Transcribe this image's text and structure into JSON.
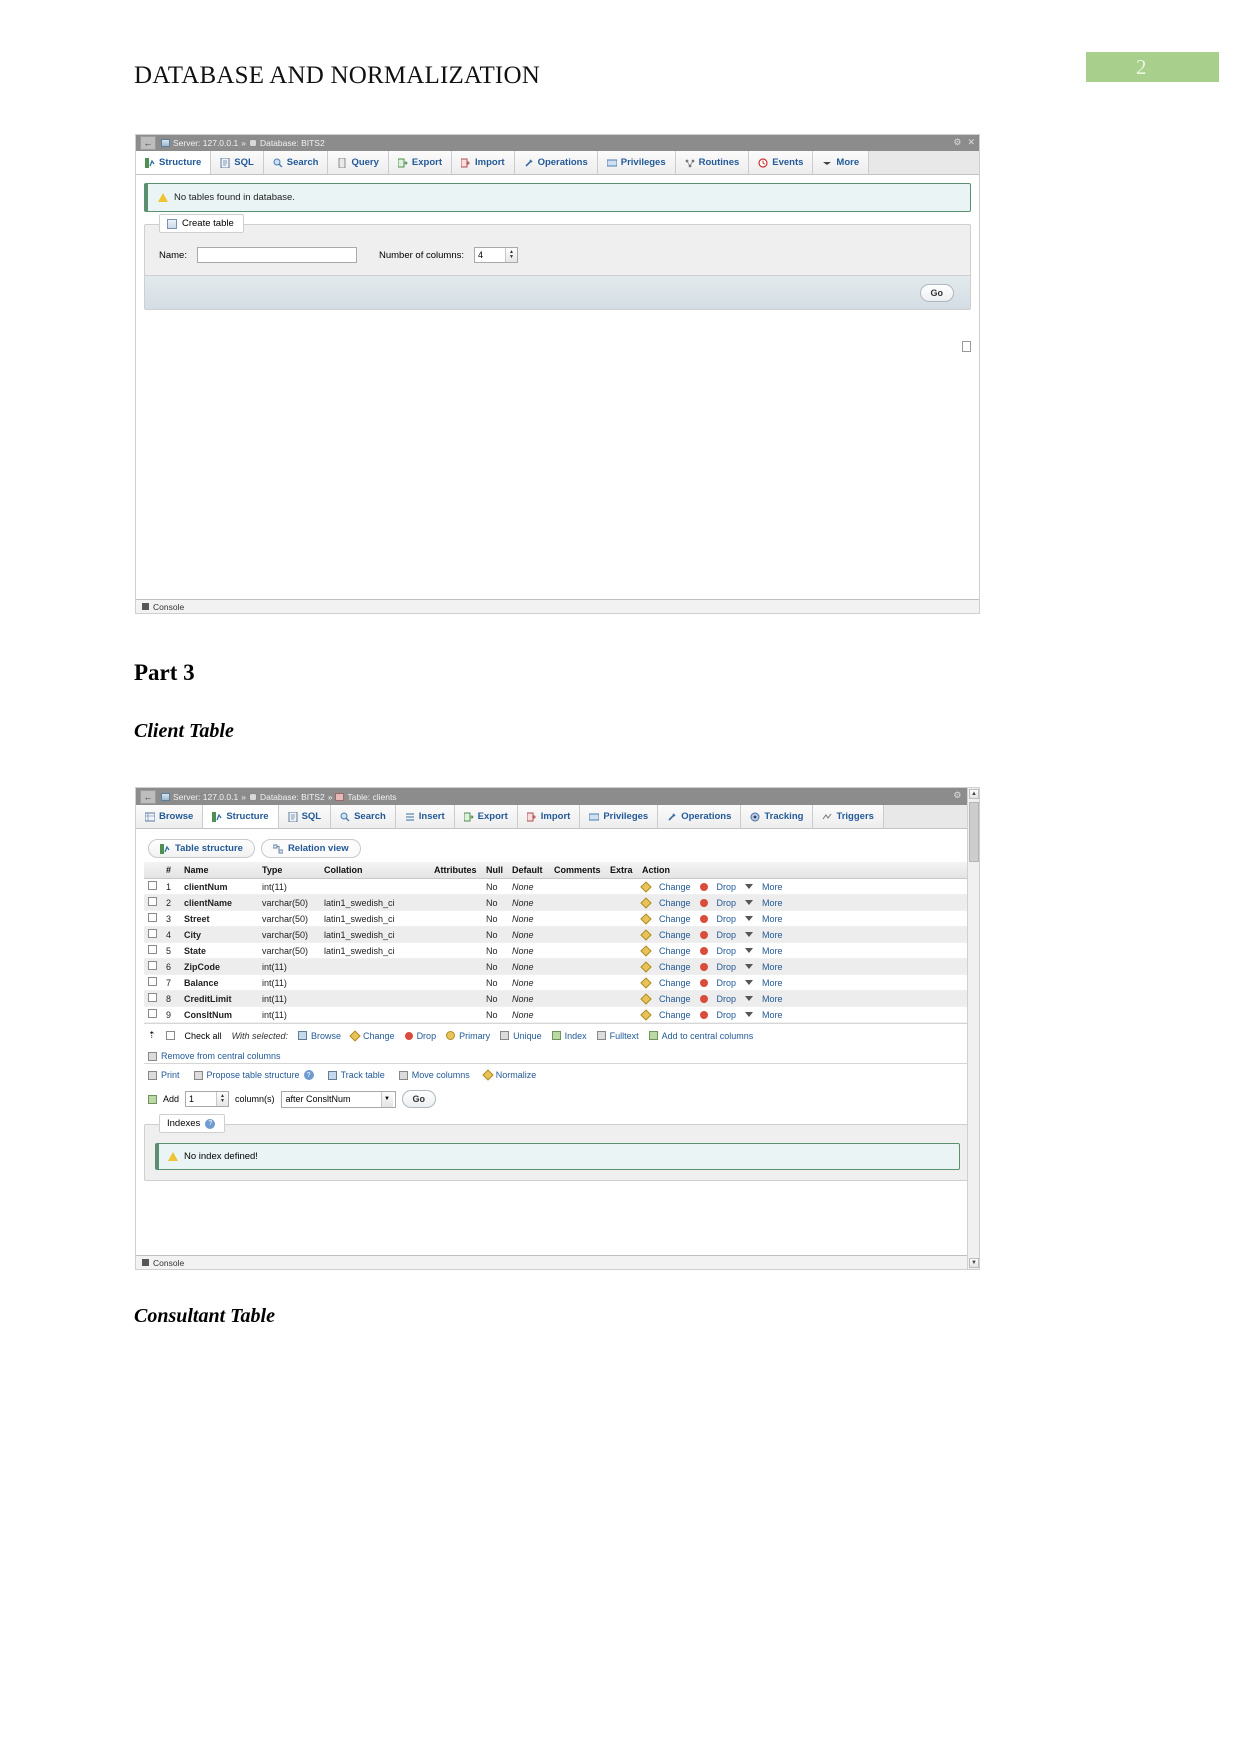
{
  "document": {
    "title": "DATABASE AND NORMALIZATION",
    "page_number": "2",
    "page_badge_color": "#a8cf8c",
    "heading_part3": "Part 3",
    "subheading_client": "Client Table",
    "subheading_consultant": "Consultant Table"
  },
  "screenshot_db": {
    "breadcrumb": {
      "back_arrow": "←",
      "server_label": "Server: 127.0.0.1",
      "separator": "»",
      "database_label": "Database: BITS2"
    },
    "window_controls": {
      "settings": "⚙",
      "collapse": "✕"
    },
    "tabs": [
      {
        "label": "Structure",
        "icon": "structure-icon",
        "active": true
      },
      {
        "label": "SQL",
        "icon": "sql-icon",
        "active": false
      },
      {
        "label": "Search",
        "icon": "search-icon",
        "active": false
      },
      {
        "label": "Query",
        "icon": "query-icon",
        "active": false
      },
      {
        "label": "Export",
        "icon": "export-icon",
        "active": false
      },
      {
        "label": "Import",
        "icon": "import-icon",
        "active": false
      },
      {
        "label": "Operations",
        "icon": "operations-icon",
        "active": false
      },
      {
        "label": "Privileges",
        "icon": "privileges-icon",
        "active": false
      },
      {
        "label": "Routines",
        "icon": "routines-icon",
        "active": false
      },
      {
        "label": "Events",
        "icon": "events-icon",
        "active": false
      },
      {
        "label": "More",
        "icon": "chevron-down-icon",
        "active": false
      }
    ],
    "notice": "No tables found in database.",
    "create_table": {
      "legend": "Create table",
      "name_label": "Name:",
      "name_value": "",
      "columns_label": "Number of columns:",
      "columns_value": "4",
      "go_label": "Go"
    },
    "console_label": "Console"
  },
  "screenshot_table": {
    "breadcrumb": {
      "back_arrow": "←",
      "server_label": "Server: 127.0.0.1",
      "separator": "»",
      "database_label": "Database: BITS2",
      "table_label": "Table: clients"
    },
    "window_controls": {
      "settings": "⚙",
      "collapse": "✕"
    },
    "tabs": [
      {
        "label": "Browse",
        "icon": "browse-icon",
        "active": false
      },
      {
        "label": "Structure",
        "icon": "structure-icon",
        "active": true
      },
      {
        "label": "SQL",
        "icon": "sql-icon",
        "active": false
      },
      {
        "label": "Search",
        "icon": "search-icon",
        "active": false
      },
      {
        "label": "Insert",
        "icon": "insert-icon",
        "active": false
      },
      {
        "label": "Export",
        "icon": "export-icon",
        "active": false
      },
      {
        "label": "Import",
        "icon": "import-icon",
        "active": false
      },
      {
        "label": "Privileges",
        "icon": "privileges-icon",
        "active": false
      },
      {
        "label": "Operations",
        "icon": "operations-icon",
        "active": false
      },
      {
        "label": "Tracking",
        "icon": "tracking-icon",
        "active": false
      },
      {
        "label": "Triggers",
        "icon": "triggers-icon",
        "active": false
      }
    ],
    "subtabs": [
      {
        "label": "Table structure",
        "icon": "structure-icon",
        "active": true
      },
      {
        "label": "Relation view",
        "icon": "relation-icon",
        "active": false
      }
    ],
    "columns_header": [
      "#",
      "Name",
      "Type",
      "Collation",
      "Attributes",
      "Null",
      "Default",
      "Comments",
      "Extra",
      "Action"
    ],
    "rows": [
      {
        "num": "1",
        "name": "clientNum",
        "type": "int(11)",
        "collation": "",
        "attributes": "",
        "null": "No",
        "default": "None",
        "comments": "",
        "extra": "",
        "actions": [
          "Change",
          "Drop",
          "More"
        ]
      },
      {
        "num": "2",
        "name": "clientName",
        "type": "varchar(50)",
        "collation": "latin1_swedish_ci",
        "attributes": "",
        "null": "No",
        "default": "None",
        "comments": "",
        "extra": "",
        "actions": [
          "Change",
          "Drop",
          "More"
        ]
      },
      {
        "num": "3",
        "name": "Street",
        "type": "varchar(50)",
        "collation": "latin1_swedish_ci",
        "attributes": "",
        "null": "No",
        "default": "None",
        "comments": "",
        "extra": "",
        "actions": [
          "Change",
          "Drop",
          "More"
        ]
      },
      {
        "num": "4",
        "name": "City",
        "type": "varchar(50)",
        "collation": "latin1_swedish_ci",
        "attributes": "",
        "null": "No",
        "default": "None",
        "comments": "",
        "extra": "",
        "actions": [
          "Change",
          "Drop",
          "More"
        ]
      },
      {
        "num": "5",
        "name": "State",
        "type": "varchar(50)",
        "collation": "latin1_swedish_ci",
        "attributes": "",
        "null": "No",
        "default": "None",
        "comments": "",
        "extra": "",
        "actions": [
          "Change",
          "Drop",
          "More"
        ]
      },
      {
        "num": "6",
        "name": "ZipCode",
        "type": "int(11)",
        "collation": "",
        "attributes": "",
        "null": "No",
        "default": "None",
        "comments": "",
        "extra": "",
        "actions": [
          "Change",
          "Drop",
          "More"
        ]
      },
      {
        "num": "7",
        "name": "Balance",
        "type": "int(11)",
        "collation": "",
        "attributes": "",
        "null": "No",
        "default": "None",
        "comments": "",
        "extra": "",
        "actions": [
          "Change",
          "Drop",
          "More"
        ]
      },
      {
        "num": "8",
        "name": "CreditLimit",
        "type": "int(11)",
        "collation": "",
        "attributes": "",
        "null": "No",
        "default": "None",
        "comments": "",
        "extra": "",
        "actions": [
          "Change",
          "Drop",
          "More"
        ]
      },
      {
        "num": "9",
        "name": "ConsltNum",
        "type": "int(11)",
        "collation": "",
        "attributes": "",
        "null": "No",
        "default": "None",
        "comments": "",
        "extra": "",
        "actions": [
          "Change",
          "Drop",
          "More"
        ]
      }
    ],
    "with_selected": {
      "check_all": "Check all",
      "label": "With selected:",
      "actions": [
        "Browse",
        "Change",
        "Drop",
        "Primary",
        "Unique",
        "Index",
        "Fulltext",
        "Add to central columns",
        "Remove from central columns"
      ]
    },
    "tools": [
      "Print",
      "Propose table structure",
      "Track table",
      "Move columns",
      "Normalize"
    ],
    "add_row": {
      "add_label": "Add",
      "count_value": "1",
      "columns_label": "column(s)",
      "position_value": "after ConsltNum",
      "go_label": "Go"
    },
    "indexes": {
      "legend": "Indexes",
      "help_icon": "?",
      "no_index_message": "No index defined!"
    },
    "console_label": "Console"
  }
}
